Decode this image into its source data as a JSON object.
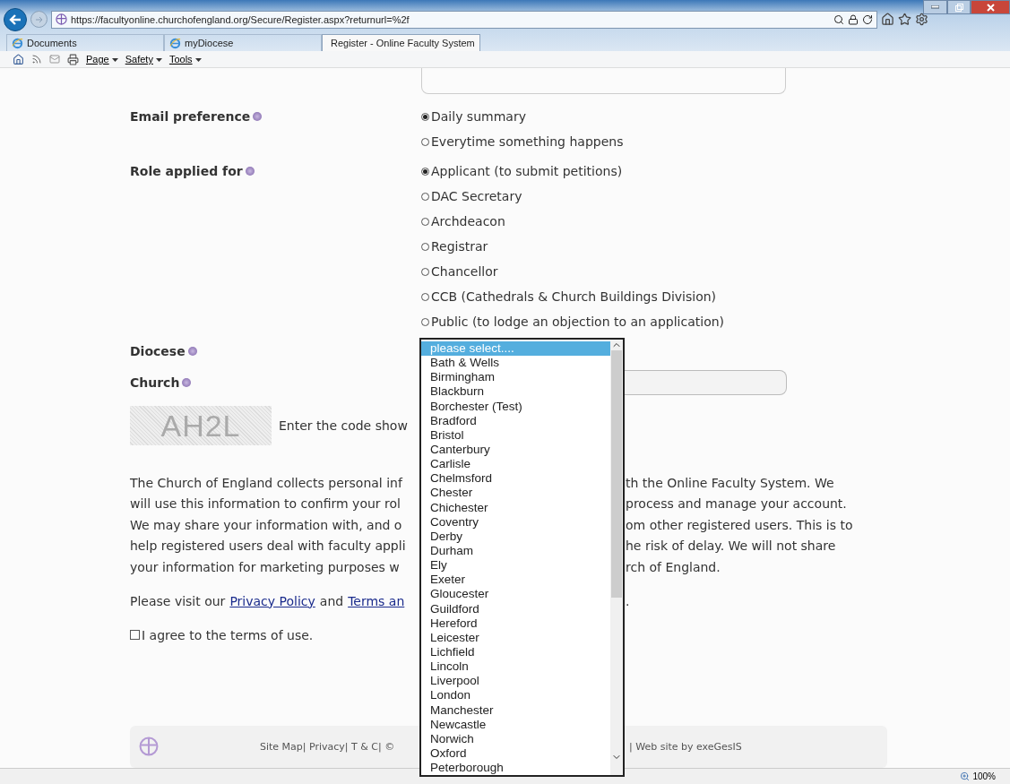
{
  "browser": {
    "url": "https://facultyonline.churchofengland.org/Secure/Register.aspx?returnurl=%2f",
    "tabs": [
      {
        "label": "Documents",
        "kind": "ie",
        "selected": false
      },
      {
        "label": "myDiocese",
        "kind": "ie",
        "selected": false
      },
      {
        "label": "Register - Online Faculty System",
        "kind": "site",
        "selected": true
      }
    ],
    "menu": [
      "Page",
      "Safety",
      "Tools"
    ],
    "zoom": "100%"
  },
  "form": {
    "email": {
      "label": "Email preference",
      "options": [
        {
          "label": "Daily summary",
          "selected": true
        },
        {
          "label": "Everytime something happens",
          "selected": false
        }
      ]
    },
    "role": {
      "label": "Role applied for",
      "options": [
        {
          "label": "Applicant (to submit petitions)",
          "selected": true
        },
        {
          "label": "DAC Secretary",
          "selected": false
        },
        {
          "label": "Archdeacon",
          "selected": false
        },
        {
          "label": "Registrar",
          "selected": false
        },
        {
          "label": "Chancellor",
          "selected": false
        },
        {
          "label": "CCB (Cathedrals & Church Buildings Division)",
          "selected": false
        },
        {
          "label": "Public (to lodge an objection to an application)",
          "selected": false
        }
      ]
    },
    "diocese": {
      "label": "Diocese"
    },
    "church": {
      "label": "Church"
    },
    "captcha": {
      "code": "AH2L",
      "prompt": "Enter the code show"
    }
  },
  "notice_lines": [
    {
      "left": "The Church of England collects personal inf",
      "right": "th the Online Faculty System. We"
    },
    {
      "left": "will use this information to confirm your rol",
      "right": "process and manage your account."
    },
    {
      "left": "We may share your information with, and o",
      "right": "om other registered users. This is to"
    },
    {
      "left": "help registered users deal with faculty appli",
      "right": "he risk of delay. We will not share"
    },
    {
      "left": "your information for marketing purposes w",
      "right": "rch of England."
    }
  ],
  "privacy": {
    "before": "Please visit our",
    "link_1": "Privacy Policy",
    "middle": "and",
    "link_2": "Terms an",
    "after": "."
  },
  "agree": {
    "label": "I agree to the terms of use.",
    "checked": false
  },
  "footer": {
    "left": "Site Map| Privacy| T & C| ©",
    "right": "| Web site by exeGesIS"
  },
  "dropdown": {
    "options": [
      {
        "label": "please select....",
        "selected": true
      },
      {
        "label": "Bath & Wells",
        "selected": false
      },
      {
        "label": "Birmingham",
        "selected": false
      },
      {
        "label": "Blackburn",
        "selected": false
      },
      {
        "label": "Borchester (Test)",
        "selected": false
      },
      {
        "label": "Bradford",
        "selected": false
      },
      {
        "label": "Bristol",
        "selected": false
      },
      {
        "label": "Canterbury",
        "selected": false
      },
      {
        "label": "Carlisle",
        "selected": false
      },
      {
        "label": "Chelmsford",
        "selected": false
      },
      {
        "label": "Chester",
        "selected": false
      },
      {
        "label": "Chichester",
        "selected": false
      },
      {
        "label": "Coventry",
        "selected": false
      },
      {
        "label": "Derby",
        "selected": false
      },
      {
        "label": "Durham",
        "selected": false
      },
      {
        "label": "Ely",
        "selected": false
      },
      {
        "label": "Exeter",
        "selected": false
      },
      {
        "label": "Gloucester",
        "selected": false
      },
      {
        "label": "Guildford",
        "selected": false
      },
      {
        "label": "Hereford",
        "selected": false
      },
      {
        "label": "Leicester",
        "selected": false
      },
      {
        "label": "Lichfield",
        "selected": false
      },
      {
        "label": "Lincoln",
        "selected": false
      },
      {
        "label": "Liverpool",
        "selected": false
      },
      {
        "label": "London",
        "selected": false
      },
      {
        "label": "Manchester",
        "selected": false
      },
      {
        "label": "Newcastle",
        "selected": false
      },
      {
        "label": "Norwich",
        "selected": false
      },
      {
        "label": "Oxford",
        "selected": false
      },
      {
        "label": "Peterborough",
        "selected": false
      }
    ]
  }
}
